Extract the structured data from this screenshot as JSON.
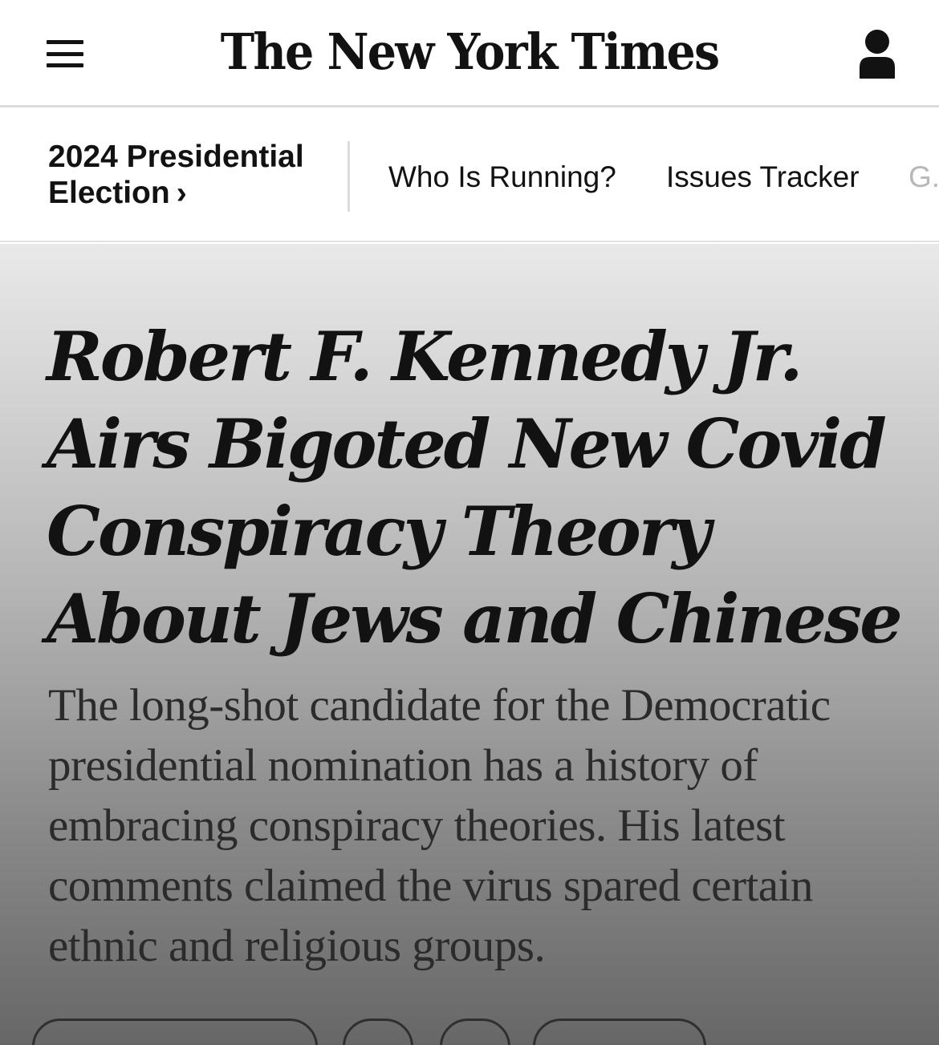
{
  "masthead": {
    "logo_text": "The New York Times",
    "menu_icon": "hamburger-menu-icon",
    "account_icon": "person-account-icon"
  },
  "section_nav": {
    "section_title": "2024 Presidential Election",
    "chevron": "›",
    "links": [
      {
        "label": "Who Is Running?"
      },
      {
        "label": "Issues Tracker"
      },
      {
        "label": "G..."
      }
    ]
  },
  "article": {
    "headline": "Robert F. Kennedy Jr. Airs Bigoted New Covid Conspiracy Theory About Jews and Chinese",
    "summary": "The long-shot candidate for the Democratic presidential nomination has a history of embracing conspiracy theories. His latest comments claimed the virus spared certain ethnic and religious groups."
  },
  "colors": {
    "text": "#121212",
    "summary_text": "#2b2b2b",
    "faded_link": "#b8b8b8",
    "divider": "#dcdcdc"
  }
}
